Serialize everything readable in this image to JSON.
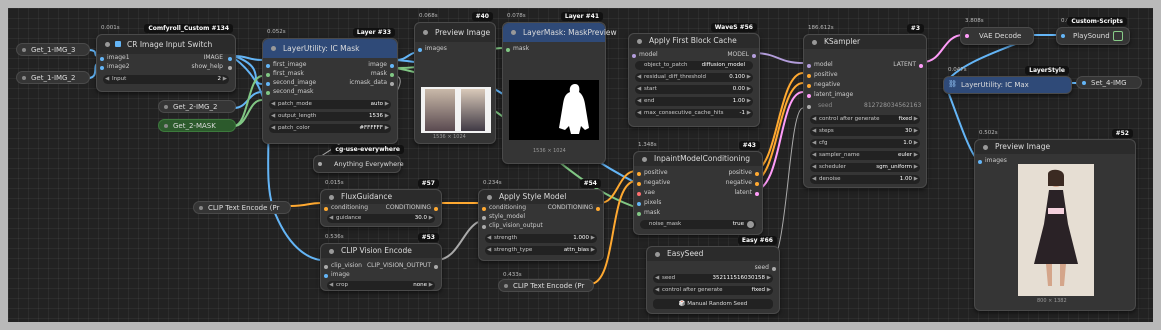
{
  "nodes": {
    "get_img3": {
      "label": "Get_1-IMG_3"
    },
    "get_img2": {
      "label": "Get_1-IMG_2"
    },
    "get2_img2": {
      "label": "Get_2-IMG_2"
    },
    "get2_mask": {
      "label": "Get_2-MASK"
    },
    "clip_text_1": {
      "label": "CLIP Text Encode (Pr"
    },
    "clip_text_2": {
      "label": "CLIP Text Encode (Pr",
      "timing": "0.433s"
    },
    "cr_switch": {
      "title": "CR Image Input Switch",
      "badge": "Comfyroll_Custom #134",
      "timing": "0.001s",
      "in1": "image1",
      "in2": "image2",
      "out1": "IMAGE",
      "out2": "show_help",
      "input_label": "Input",
      "input_value": "2"
    },
    "ic_mask": {
      "title": "LayerUtility: IC Mask",
      "badge": "Layer #33",
      "timing": "0.052s",
      "inputs": [
        "first_image",
        "first_mask",
        "second_image",
        "second_mask"
      ],
      "outputs": [
        "image",
        "mask",
        "icmask_data"
      ],
      "fields": [
        {
          "label": "patch_mode",
          "value": "auto"
        },
        {
          "label": "output_length",
          "value": "1536"
        },
        {
          "label": "patch_color",
          "value": "#FFFFFF"
        }
      ]
    },
    "anything": {
      "title": "Anything Everywhere",
      "badge": "cg-use-everywhere",
      "input": "anything"
    },
    "preview1": {
      "title": "Preview Image",
      "badge": "#40",
      "timing": "0.068s",
      "input": "images",
      "dims": "1536 × 1024"
    },
    "maskprev": {
      "title": "LayerMask: MaskPreview",
      "badge": "Layer #41",
      "timing": "0.078s",
      "input": "mask",
      "dims": "1536 × 1024"
    },
    "flux": {
      "title": "FluxGuidance",
      "badge": "#57",
      "timing": "0.015s",
      "in": "conditioning",
      "out": "CONDITIONING",
      "field_label": "guidance",
      "field_value": "30.0"
    },
    "clipvision": {
      "title": "CLIP Vision Encode",
      "badge": "#53",
      "timing": "0.536s",
      "in1": "clip_vision",
      "in2": "image",
      "out": "CLIP_VISION_OUTPUT",
      "field_label": "crop",
      "field_value": "none"
    },
    "style": {
      "title": "Apply Style Model",
      "badge": "#54",
      "timing": "0.234s",
      "inputs": [
        "conditioning",
        "style_model",
        "clip_vision_output"
      ],
      "out": "CONDITIONING",
      "fields": [
        {
          "label": "strength",
          "value": "1.000"
        },
        {
          "label": "strength_type",
          "value": "attn_bias"
        }
      ]
    },
    "fbc": {
      "title": "Apply First Block Cache",
      "badge": "WaveS #56",
      "in": "model",
      "out": "MODEL",
      "fields": [
        {
          "label": "object_to_patch",
          "value": "diffusion_model"
        },
        {
          "label": "residual_diff_threshold",
          "value": "0.100"
        },
        {
          "label": "start",
          "value": "0.00"
        },
        {
          "label": "end",
          "value": "1.00"
        },
        {
          "label": "max_consecutive_cache_hits",
          "value": "-1"
        }
      ]
    },
    "inpaint": {
      "title": "InpaintModelConditioning",
      "badge": "#43",
      "timing": "1.348s",
      "inputs": [
        "positive",
        "negative",
        "vae",
        "pixels",
        "mask"
      ],
      "outputs": [
        "positive",
        "negative",
        "latent"
      ],
      "toggle_label": "noise_mask",
      "toggle_value": "true"
    },
    "easyseed": {
      "title": "EasySeed",
      "badge": "Easy #66",
      "out": "seed",
      "fields": [
        {
          "label": "seed",
          "value": "352111516030158"
        },
        {
          "label": "control after generate",
          "value": "fixed"
        }
      ],
      "button": "Manual Random Seed"
    },
    "ksampler": {
      "title": "KSampler",
      "badge": "#3",
      "timing": "186.612s",
      "inputs": [
        "model",
        "positive",
        "negative",
        "latent_image"
      ],
      "out": "LATENT",
      "seed_label": "seed",
      "seed_value": "812728034562163",
      "fields": [
        {
          "label": "control after generate",
          "value": "fixed"
        },
        {
          "label": "steps",
          "value": "30"
        },
        {
          "label": "cfg",
          "value": "1.0"
        },
        {
          "label": "sampler_name",
          "value": "euler"
        },
        {
          "label": "scheduler",
          "value": "sgm_uniform"
        },
        {
          "label": "denoise",
          "value": "1.00"
        }
      ]
    },
    "vaedecode": {
      "title": "VAE Decode",
      "timing": "3.808s"
    },
    "playsound": {
      "title": "PlaySound",
      "badge": "Custom-Scripts",
      "timing": "0.003s"
    },
    "icmax": {
      "title": "LayerUtility: IC Max",
      "badge": "LayerStyle",
      "timing": "0.047s"
    },
    "set4": {
      "label": "Set_4-IMG"
    },
    "preview2": {
      "title": "Preview Image",
      "badge": "#52",
      "timing": "0.502s",
      "input": "images",
      "dims": "800 × 1382"
    }
  },
  "colors": {
    "canvas": "#222222",
    "node": "#353535",
    "title": "#2b2b2b",
    "blue_title": "#2f4a78",
    "green": "#2c5a2c",
    "wire_image": "#64b5f6",
    "wire_cond": "#ffa931",
    "wire_model": "#b39ddb",
    "wire_mask": "#81c784",
    "wire_latent": "#ff9cf9",
    "wire_vae": "#ff6e6e"
  }
}
